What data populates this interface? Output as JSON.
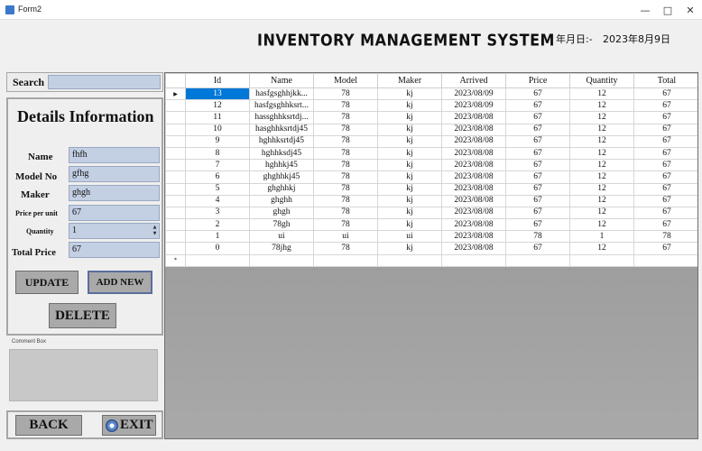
{
  "window": {
    "title": "Form2",
    "minimize": "—",
    "maximize": "□",
    "close": "✕"
  },
  "header": {
    "title": "INVENTORY MANAGEMENT SYSTEM",
    "date_label": "年月日:-",
    "date_value": "2023年8月9日"
  },
  "search": {
    "label": "Search",
    "value": ""
  },
  "details": {
    "title": "Details Information",
    "fields": {
      "name": {
        "label": "Name",
        "value": "fhfh"
      },
      "model": {
        "label": "Model No",
        "value": "gfhg"
      },
      "maker": {
        "label": "Maker",
        "value": "ghgh"
      },
      "price": {
        "label": "Price per unit",
        "value": "67"
      },
      "quantity": {
        "label": "Quantity",
        "value": "1"
      },
      "total": {
        "label": "Total Price",
        "value": "67"
      }
    }
  },
  "buttons": {
    "update": "UPDATE",
    "add_new": "ADD NEW",
    "delete": "DELETE",
    "back": "BACK",
    "exit": "EXIT"
  },
  "comment": {
    "label": "Comment Box",
    "value": ""
  },
  "grid": {
    "current_row_marker": "▶",
    "new_row_marker": "*",
    "columns": [
      "Id",
      "Name",
      "Model",
      "Maker",
      "Arrived",
      "Price",
      "Quantity",
      "Total"
    ],
    "rows": [
      [
        "13",
        "hasfgsghhjkk...",
        "78",
        "kj",
        "2023/08/09",
        "67",
        "12",
        "67"
      ],
      [
        "12",
        "hasfgsghhksrt...",
        "78",
        "kj",
        "2023/08/09",
        "67",
        "12",
        "67"
      ],
      [
        "11",
        "hassghhksrtdj...",
        "78",
        "kj",
        "2023/08/08",
        "67",
        "12",
        "67"
      ],
      [
        "10",
        "hasghhksrtdj45",
        "78",
        "kj",
        "2023/08/08",
        "67",
        "12",
        "67"
      ],
      [
        "9",
        "hghhksrtdj45",
        "78",
        "kj",
        "2023/08/08",
        "67",
        "12",
        "67"
      ],
      [
        "8",
        "hghhksdj45",
        "78",
        "kj",
        "2023/08/08",
        "67",
        "12",
        "67"
      ],
      [
        "7",
        "hghhkj45",
        "78",
        "kj",
        "2023/08/08",
        "67",
        "12",
        "67"
      ],
      [
        "6",
        "ghghhkj45",
        "78",
        "kj",
        "2023/08/08",
        "67",
        "12",
        "67"
      ],
      [
        "5",
        "ghghhkj",
        "78",
        "kj",
        "2023/08/08",
        "67",
        "12",
        "67"
      ],
      [
        "4",
        "ghghh",
        "78",
        "kj",
        "2023/08/08",
        "67",
        "12",
        "67"
      ],
      [
        "3",
        "ghgh",
        "78",
        "kj",
        "2023/08/08",
        "67",
        "12",
        "67"
      ],
      [
        "2",
        "78gh",
        "78",
        "kj",
        "2023/08/08",
        "67",
        "12",
        "67"
      ],
      [
        "1",
        "ui",
        "ui",
        "ui",
        "2023/08/08",
        "78",
        "1",
        "78"
      ],
      [
        "0",
        "78jhg",
        "78",
        "kj",
        "2023/08/08",
        "67",
        "12",
        "67"
      ]
    ]
  }
}
